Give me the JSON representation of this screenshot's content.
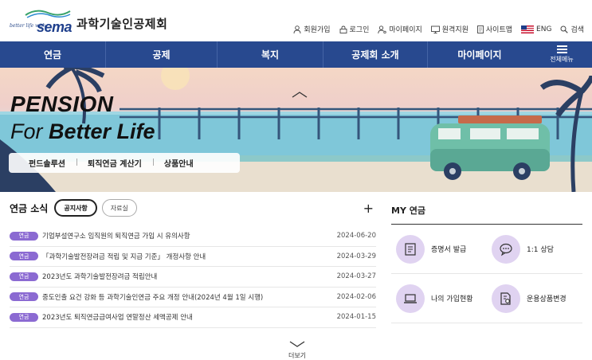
{
  "header": {
    "logo_tagline": "better life with",
    "logo_text": "sema",
    "org_name": "과학기술인공제회",
    "util_links": [
      {
        "label": "회원가입",
        "icon": "user-icon"
      },
      {
        "label": "로그인",
        "icon": "lock-icon"
      },
      {
        "label": "마이페이지",
        "icon": "user-gear-icon"
      },
      {
        "label": "원격지원",
        "icon": "monitor-icon"
      },
      {
        "label": "사이트맵",
        "icon": "document-icon"
      },
      {
        "label": "ENG",
        "icon": "us-flag-icon"
      },
      {
        "label": "검색",
        "icon": "search-icon"
      }
    ]
  },
  "nav": {
    "items": [
      "연금",
      "공제",
      "복지",
      "공제회 소개",
      "마이페이지"
    ],
    "all_menu_label": "전체메뉴"
  },
  "hero": {
    "title_line1": "PENSION",
    "title_line2_prefix": "For",
    "title_line2_bold": "Better Life",
    "tabs": [
      "펀드솔루션",
      "퇴직연금 계산기",
      "상품안내"
    ]
  },
  "news": {
    "title": "연금 소식",
    "filters": [
      {
        "label": "공지사항",
        "active": true
      },
      {
        "label": "자료실",
        "active": false
      }
    ],
    "plus_label": "+",
    "items": [
      {
        "badge": "연금",
        "text": "기업부설연구소 임직원의 퇴직연금 가입 시 유의사항",
        "date": "2024-06-20"
      },
      {
        "badge": "연금",
        "text": "「과학기술발전장려금 적립 및 지급 기준」 개정사항 안내",
        "date": "2024-03-29"
      },
      {
        "badge": "연금",
        "text": "2023년도 과학기술발전장려금 적립안내",
        "date": "2024-03-27"
      },
      {
        "badge": "연금",
        "text": "중도인출 요건 강화 등 과학기술인연금 주요 개정 안내(2024년 4월 1일 시행)",
        "date": "2024-02-06"
      },
      {
        "badge": "연금",
        "text": "2023년도 퇴직연금급여사업 연말정산 세액공제 안내",
        "date": "2024-01-15"
      }
    ],
    "more_label": "더보기"
  },
  "my": {
    "title": "MY 연금",
    "items": [
      {
        "label": "증명서 발급",
        "icon": "certificate-icon"
      },
      {
        "label": "1:1 상담",
        "icon": "chat-bubble-icon"
      },
      {
        "label": "나의 가입현황",
        "icon": "laptop-icon"
      },
      {
        "label": "운용상품변경",
        "icon": "document-settings-icon"
      }
    ]
  },
  "colors": {
    "nav_bg": "#28498f",
    "badge": "#8b6ad2",
    "my_icon_bg": "#e0d3f1",
    "logo_blue": "#1e3f8c"
  }
}
